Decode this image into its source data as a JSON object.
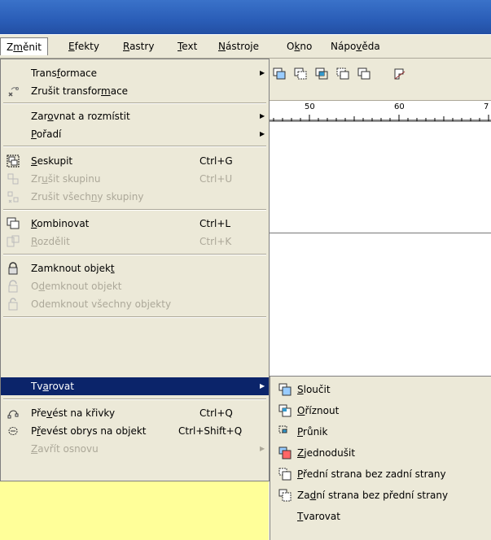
{
  "menubar": {
    "items": [
      {
        "pre": "Z",
        "u": "m",
        "post": "ěnit"
      },
      {
        "pre": "",
        "u": "E",
        "post": "fekty"
      },
      {
        "pre": "",
        "u": "R",
        "post": "astry"
      },
      {
        "pre": "",
        "u": "T",
        "post": "ext"
      },
      {
        "pre": "",
        "u": "N",
        "post": "ástroje"
      },
      {
        "pre": "O",
        "u": "k",
        "post": "no"
      },
      {
        "pre": "Nápo",
        "u": "v",
        "post": "ěda"
      }
    ]
  },
  "ruler": {
    "labels": [
      "50",
      "60",
      "7"
    ]
  },
  "menu": {
    "items": [
      {
        "pre": "Trans",
        "u": "f",
        "post": "ormace",
        "shortcut": "",
        "arrow": "▶",
        "icon": "none"
      },
      {
        "pre": "Zrušit transfor",
        "u": "m",
        "post": "ace",
        "shortcut": "",
        "arrow": "",
        "icon": "clear-transform-icon"
      },
      {
        "pre": "Zar",
        "u": "o",
        "post": "vnat a rozmístit",
        "shortcut": "",
        "arrow": "▶",
        "icon": "none"
      },
      {
        "pre": "",
        "u": "P",
        "post": "ořadí",
        "shortcut": "",
        "arrow": "▶",
        "icon": "none"
      },
      {
        "pre": "",
        "u": "S",
        "post": "eskupit",
        "shortcut": "Ctrl+G",
        "arrow": "",
        "icon": "group-icon"
      },
      {
        "pre": "Zr",
        "u": "u",
        "post": "šit skupinu",
        "shortcut": "Ctrl+U",
        "arrow": "",
        "icon": "ungroup-icon"
      },
      {
        "pre": "Zrušit všech",
        "u": "n",
        "post": "y skupiny",
        "shortcut": "",
        "arrow": "",
        "icon": "ungroup-all-icon"
      },
      {
        "pre": "",
        "u": "K",
        "post": "ombinovat",
        "shortcut": "Ctrl+L",
        "arrow": "",
        "icon": "combine-icon"
      },
      {
        "pre": "",
        "u": "R",
        "post": "ozdělit",
        "shortcut": "Ctrl+K",
        "arrow": "",
        "icon": "break-apart-icon"
      },
      {
        "pre": "Zamknout objek",
        "u": "t",
        "post": "",
        "shortcut": "",
        "arrow": "",
        "icon": "lock-icon"
      },
      {
        "pre": "O",
        "u": "d",
        "post": "emknout objekt",
        "shortcut": "",
        "arrow": "",
        "icon": "unlock-icon"
      },
      {
        "pre": "Odemknout všechny ob",
        "u": "j",
        "post": "ekty",
        "shortcut": "",
        "arrow": "",
        "icon": "unlock-all-icon"
      },
      {
        "pre": "Tv",
        "u": "a",
        "post": "rovat",
        "shortcut": "",
        "arrow": "▶",
        "icon": "none"
      },
      {
        "pre": "Pře",
        "u": "v",
        "post": "ést na křivky",
        "shortcut": "Ctrl+Q",
        "arrow": "",
        "icon": "convert-to-curves-icon"
      },
      {
        "pre": "P",
        "u": "ř",
        "post": "evést obrys na objekt",
        "shortcut": "Ctrl+Shift+Q",
        "arrow": "",
        "icon": "outline-to-object-icon"
      },
      {
        "pre": "",
        "u": "Z",
        "post": "avřít osnovu",
        "shortcut": "",
        "arrow": "▶",
        "icon": "none"
      }
    ]
  },
  "submenu": {
    "items": [
      {
        "pre": "",
        "u": "S",
        "post": "loučit",
        "icon": "weld-icon"
      },
      {
        "pre": "",
        "u": "O",
        "post": "říznout",
        "icon": "trim-icon"
      },
      {
        "pre": "",
        "u": "P",
        "post": "růnik",
        "icon": "intersect-icon"
      },
      {
        "pre": "",
        "u": "Z",
        "post": "jednodušit",
        "icon": "simplify-icon"
      },
      {
        "pre": "",
        "u": "P",
        "post": "řední strana bez zadní strany",
        "icon": "front-minus-back-icon"
      },
      {
        "pre": "Za",
        "u": "d",
        "post": "ní strana bez přední strany",
        "icon": "back-minus-front-icon"
      },
      {
        "pre": "",
        "u": "T",
        "post": "varovat",
        "icon": "none"
      }
    ]
  },
  "colors": {
    "highlight": "#0b246a",
    "menu_bg": "#ece9d8",
    "disabled": "#aca899",
    "background": "#ffff99",
    "titlebar": "#2a5db7"
  }
}
